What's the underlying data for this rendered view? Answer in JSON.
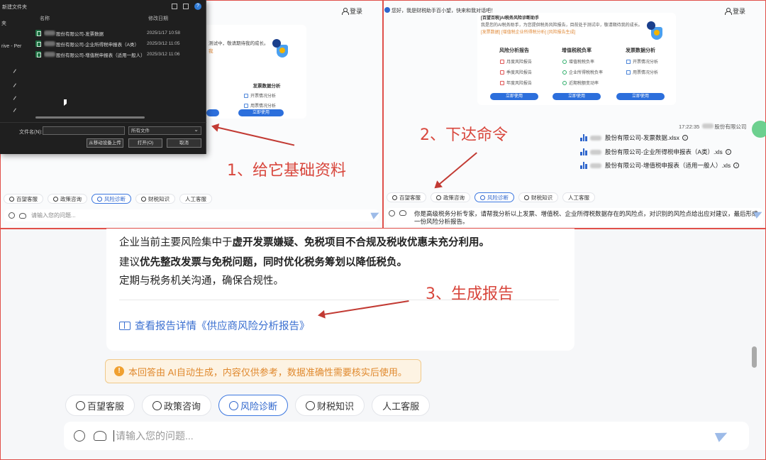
{
  "panel1": {
    "login": "登录",
    "dialog": {
      "title": "新建文件夹",
      "side_items": [
        "夹",
        "rive - Per"
      ],
      "col_name": "名称",
      "col_date": "修改日期",
      "files": [
        {
          "name": "股份有限公司-发票数据",
          "date": "2025/1/17 10:58"
        },
        {
          "name": "股份有限公司-企业所得税申报表（A类）",
          "date": "2025/3/12 11:05"
        },
        {
          "name": "股份有限公司-增值税申报表（适用一般人）",
          "date": "2025/3/12 11:06"
        }
      ],
      "filename_label": "文件名(N):",
      "filetype": "所有文件",
      "upload_mobile": "从移动设备上传",
      "open": "打开(O)",
      "cancel": "取消"
    },
    "card_text1": "测试中，敬请期待我的成长。",
    "card_text2": "我",
    "subcard_title": "发票数据分析",
    "subcard_items": [
      "开票情况分析",
      "用票情况分析"
    ],
    "use_btn": "立即使用",
    "annotation": "1、给它基础资料",
    "quick": [
      "百望客服",
      "政策咨询",
      "风险诊断",
      "财税知识",
      "人工客服"
    ],
    "input_placeholder": "请输入您的问题..."
  },
  "panel2": {
    "login": "登录",
    "greeting": "您好，我是财税助手百小望，快来和我对话吧！",
    "card_title": "[百望百税]AI税务风险诊断助手",
    "card_desc": "我是您的AI税务助手，为您提供税务风险报告，目前处于测试中，敬请期待我的成长。",
    "card_tags": "[发票数据] [增值税企业所得税分析] [风险报告生成]",
    "columns": [
      {
        "title": "风险分析报告",
        "items": [
          "月度风险报告",
          "季度风险报告",
          "年度风险报告"
        ]
      },
      {
        "title": "增值税税负率",
        "items": [
          "增值税税负率",
          "企业所得税税负率",
          "近期税额变动率"
        ]
      },
      {
        "title": "发票数据分析",
        "items": [
          "开票情况分析",
          "用票情况分析"
        ]
      }
    ],
    "use_btn": "立即使用",
    "time": "17:22:35",
    "company": "股份有限公司",
    "files": [
      "股份有限公司-发票数据.xlsx",
      "股份有限公司-企业所得税申报表（A类）.xls",
      "股份有限公司-增值税申报表（适用一般人）.xls"
    ],
    "annotation": "2、下达命令",
    "quick": [
      "百望客服",
      "政策咨询",
      "风险诊断",
      "财税知识",
      "人工客服"
    ],
    "typed_text": "你是高级税务分析专家，请帮我分析以上发票、增值税、企业所得税数据存在的风险点，对识别的风险点给出应对建议，最后形成一份风险分析报告。"
  },
  "panel3": {
    "line1_a": "企业当前主要风险集中于",
    "line1_b": "虚开发票嫌疑、免税项目不合规及税收优惠未充分利用。",
    "line2_a": "建议",
    "line2_b": "优先整改发票与免税问题，同时优化税务筹划以降低税负。",
    "line3": "定期与税务机关沟通，确保合规性。",
    "report_link": "查看报告详情《供应商风险分析报告》",
    "annotation": "3、生成报告",
    "warning": "本回答由 AI自动生成，内容仅供参考，数据准确性需要核实后使用。",
    "quick": [
      "百望客服",
      "政策咨询",
      "风险诊断",
      "财税知识",
      "人工客服"
    ],
    "input_placeholder": "请输入您的问题..."
  },
  "colors": {
    "frame": "#e0504a",
    "annotation": "#d8463c",
    "accent": "#3a6fd0",
    "warning": "#e0892e"
  }
}
